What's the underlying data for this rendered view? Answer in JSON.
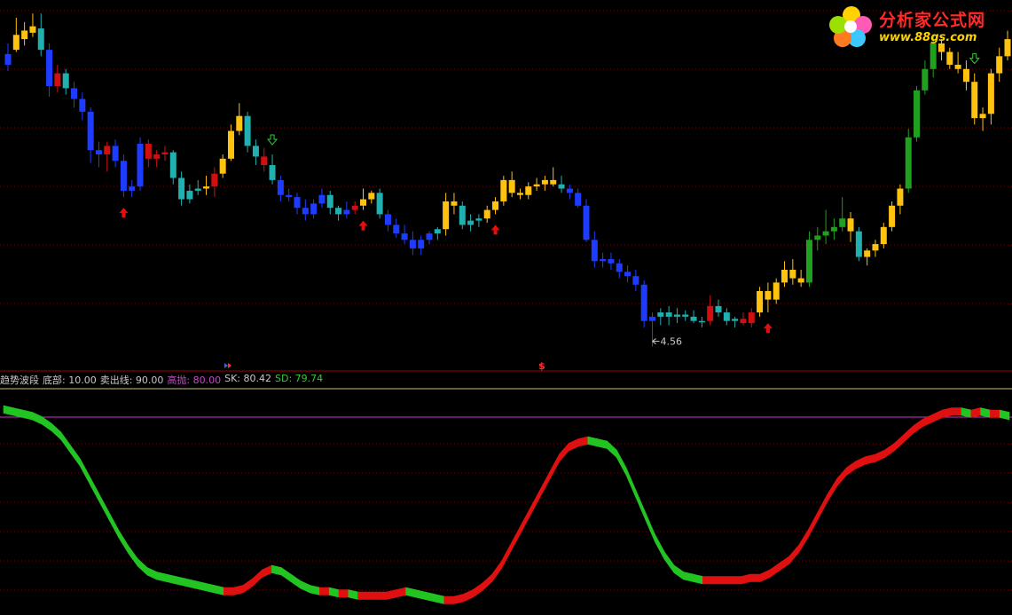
{
  "indicator": {
    "name": "趋势波段",
    "bottom_label": "底部: 10.00",
    "sell_label": "卖出线: 90.00",
    "high_label": "高抛: 80.00",
    "sk_label": "SK: 80.42",
    "sd_label": "SD: 79.74"
  },
  "price_annotation": "4.56",
  "signal_marker": "$",
  "logo": {
    "brand": "分析家公式网",
    "url": "www.88gs.com"
  },
  "colors": {
    "up_strong": "#ffc20e",
    "down_strong": "#1e3cff",
    "up_weak": "#d01010",
    "down_weak": "#20b0b0",
    "green": "#1fa01f",
    "grid": "#7a0000",
    "osc_green": "#22c422",
    "osc_red": "#e01010",
    "sell_line": "#cc33cc",
    "buy_arrow": "#e01010",
    "sell_arrow": "#33cc33"
  },
  "chart_data": [
    {
      "type": "candlestick",
      "low_annotation": 4.56,
      "ohlc": [
        [
          5.88,
          5.98,
          5.85,
          5.93,
          "b"
        ],
        [
          5.95,
          6.1,
          5.94,
          6.02,
          "y"
        ],
        [
          6.0,
          6.08,
          5.97,
          6.04,
          "y"
        ],
        [
          6.03,
          6.12,
          6.01,
          6.06,
          "y"
        ],
        [
          6.05,
          6.12,
          5.92,
          5.95,
          "c"
        ],
        [
          5.95,
          5.98,
          5.73,
          5.78,
          "b"
        ],
        [
          5.78,
          5.88,
          5.75,
          5.84,
          "r"
        ],
        [
          5.84,
          5.86,
          5.74,
          5.77,
          "c"
        ],
        [
          5.77,
          5.8,
          5.68,
          5.72,
          "b"
        ],
        [
          5.72,
          5.75,
          5.62,
          5.66,
          "b"
        ],
        [
          5.66,
          5.68,
          5.42,
          5.48,
          "b"
        ],
        [
          5.48,
          5.52,
          5.4,
          5.46,
          "b"
        ],
        [
          5.46,
          5.52,
          5.38,
          5.5,
          "r"
        ],
        [
          5.5,
          5.53,
          5.4,
          5.43,
          "b"
        ],
        [
          5.43,
          5.46,
          5.26,
          5.29,
          "b"
        ],
        [
          5.29,
          5.34,
          5.26,
          5.31,
          "b"
        ],
        [
          5.31,
          5.54,
          5.29,
          5.51,
          "b"
        ],
        [
          5.51,
          5.53,
          5.4,
          5.44,
          "r"
        ],
        [
          5.44,
          5.48,
          5.4,
          5.46,
          "r"
        ],
        [
          5.46,
          5.5,
          5.43,
          5.47,
          "r"
        ],
        [
          5.47,
          5.48,
          5.32,
          5.35,
          "c"
        ],
        [
          5.35,
          5.38,
          5.22,
          5.25,
          "c"
        ],
        [
          5.25,
          5.32,
          5.23,
          5.29,
          "c"
        ],
        [
          5.29,
          5.34,
          5.27,
          5.3,
          "c"
        ],
        [
          5.3,
          5.36,
          5.27,
          5.31,
          "y"
        ],
        [
          5.31,
          5.4,
          5.26,
          5.37,
          "r"
        ],
        [
          5.37,
          5.46,
          5.35,
          5.44,
          "y"
        ],
        [
          5.44,
          5.6,
          5.43,
          5.57,
          "y"
        ],
        [
          5.57,
          5.7,
          5.55,
          5.64,
          "y"
        ],
        [
          5.64,
          5.66,
          5.47,
          5.5,
          "c"
        ],
        [
          5.5,
          5.53,
          5.41,
          5.45,
          "c"
        ],
        [
          5.45,
          5.49,
          5.38,
          5.41,
          "r"
        ],
        [
          5.41,
          5.46,
          5.32,
          5.34,
          "c"
        ],
        [
          5.34,
          5.36,
          5.24,
          5.27,
          "b"
        ],
        [
          5.27,
          5.3,
          5.24,
          5.26,
          "b"
        ],
        [
          5.26,
          5.28,
          5.18,
          5.21,
          "b"
        ],
        [
          5.21,
          5.25,
          5.15,
          5.18,
          "b"
        ],
        [
          5.18,
          5.25,
          5.16,
          5.23,
          "b"
        ],
        [
          5.23,
          5.3,
          5.21,
          5.27,
          "b"
        ],
        [
          5.27,
          5.29,
          5.18,
          5.21,
          "c"
        ],
        [
          5.21,
          5.22,
          5.15,
          5.18,
          "c"
        ],
        [
          5.18,
          5.24,
          5.16,
          5.2,
          "b"
        ],
        [
          5.2,
          5.24,
          5.18,
          5.22,
          "r"
        ],
        [
          5.22,
          5.3,
          5.2,
          5.25,
          "y"
        ],
        [
          5.25,
          5.29,
          5.23,
          5.28,
          "y"
        ],
        [
          5.28,
          5.3,
          5.16,
          5.18,
          "c"
        ],
        [
          5.18,
          5.2,
          5.1,
          5.13,
          "b"
        ],
        [
          5.13,
          5.16,
          5.07,
          5.09,
          "b"
        ],
        [
          5.09,
          5.13,
          5.04,
          5.06,
          "b"
        ],
        [
          5.06,
          5.1,
          4.99,
          5.02,
          "b"
        ],
        [
          5.02,
          5.08,
          4.99,
          5.06,
          "b"
        ],
        [
          5.06,
          5.1,
          5.04,
          5.09,
          "b"
        ],
        [
          5.09,
          5.12,
          5.06,
          5.11,
          "c"
        ],
        [
          5.11,
          5.28,
          5.08,
          5.24,
          "y"
        ],
        [
          5.24,
          5.28,
          5.18,
          5.22,
          "y"
        ],
        [
          5.22,
          5.24,
          5.11,
          5.13,
          "c"
        ],
        [
          5.13,
          5.18,
          5.1,
          5.15,
          "c"
        ],
        [
          5.15,
          5.18,
          5.12,
          5.16,
          "c"
        ],
        [
          5.16,
          5.22,
          5.14,
          5.2,
          "y"
        ],
        [
          5.2,
          5.26,
          5.18,
          5.24,
          "y"
        ],
        [
          5.24,
          5.36,
          5.22,
          5.34,
          "y"
        ],
        [
          5.34,
          5.38,
          5.26,
          5.28,
          "y"
        ],
        [
          5.28,
          5.3,
          5.25,
          5.27,
          "y"
        ],
        [
          5.27,
          5.33,
          5.25,
          5.31,
          "y"
        ],
        [
          5.31,
          5.35,
          5.29,
          5.32,
          "y"
        ],
        [
          5.32,
          5.36,
          5.29,
          5.34,
          "y"
        ],
        [
          5.34,
          5.4,
          5.31,
          5.32,
          "y"
        ],
        [
          5.32,
          5.36,
          5.28,
          5.3,
          "c"
        ],
        [
          5.3,
          5.32,
          5.25,
          5.28,
          "b"
        ],
        [
          5.28,
          5.3,
          5.21,
          5.22,
          "b"
        ],
        [
          5.22,
          5.25,
          5.05,
          5.06,
          "b"
        ],
        [
          5.06,
          5.1,
          4.93,
          4.96,
          "b"
        ],
        [
          4.96,
          5.0,
          4.93,
          4.97,
          "b"
        ],
        [
          4.97,
          5.0,
          4.92,
          4.95,
          "b"
        ],
        [
          4.95,
          4.97,
          4.88,
          4.91,
          "b"
        ],
        [
          4.91,
          4.94,
          4.86,
          4.89,
          "b"
        ],
        [
          4.89,
          4.92,
          4.82,
          4.85,
          "b"
        ],
        [
          4.85,
          4.87,
          4.65,
          4.68,
          "b"
        ],
        [
          4.68,
          4.72,
          4.56,
          4.7,
          "b"
        ],
        [
          4.7,
          4.74,
          4.66,
          4.72,
          "c"
        ],
        [
          4.72,
          4.75,
          4.66,
          4.7,
          "c"
        ],
        [
          4.7,
          4.74,
          4.67,
          4.71,
          "c"
        ],
        [
          4.71,
          4.73,
          4.68,
          4.7,
          "c"
        ],
        [
          4.7,
          4.73,
          4.67,
          4.68,
          "c"
        ],
        [
          4.68,
          4.7,
          4.65,
          4.68,
          "c"
        ],
        [
          4.68,
          4.8,
          4.66,
          4.75,
          "r"
        ],
        [
          4.75,
          4.78,
          4.7,
          4.72,
          "c"
        ],
        [
          4.72,
          4.74,
          4.66,
          4.68,
          "c"
        ],
        [
          4.68,
          4.7,
          4.65,
          4.69,
          "c"
        ],
        [
          4.69,
          4.72,
          4.66,
          4.67,
          "r"
        ],
        [
          4.67,
          4.74,
          4.65,
          4.72,
          "r"
        ],
        [
          4.72,
          4.84,
          4.7,
          4.82,
          "y"
        ],
        [
          4.82,
          4.86,
          4.72,
          4.78,
          "y"
        ],
        [
          4.78,
          4.88,
          4.76,
          4.86,
          "y"
        ],
        [
          4.86,
          4.96,
          4.84,
          4.92,
          "y"
        ],
        [
          4.92,
          4.97,
          4.85,
          4.88,
          "y"
        ],
        [
          4.88,
          4.92,
          4.84,
          4.86,
          "y"
        ],
        [
          4.86,
          5.1,
          4.84,
          5.06,
          "g"
        ],
        [
          5.06,
          5.12,
          5.01,
          5.08,
          "g"
        ],
        [
          5.08,
          5.2,
          5.04,
          5.1,
          "g"
        ],
        [
          5.1,
          5.16,
          5.06,
          5.12,
          "g"
        ],
        [
          5.12,
          5.26,
          5.1,
          5.16,
          "g"
        ],
        [
          5.16,
          5.19,
          5.05,
          5.1,
          "y"
        ],
        [
          5.1,
          5.12,
          4.96,
          4.98,
          "c"
        ],
        [
          4.98,
          5.02,
          4.94,
          5.01,
          "y"
        ],
        [
          5.01,
          5.06,
          4.98,
          5.04,
          "y"
        ],
        [
          5.04,
          5.14,
          5.02,
          5.12,
          "y"
        ],
        [
          5.12,
          5.24,
          5.1,
          5.22,
          "y"
        ],
        [
          5.22,
          5.32,
          5.18,
          5.3,
          "y"
        ],
        [
          5.3,
          5.58,
          5.28,
          5.54,
          "g"
        ],
        [
          5.54,
          5.78,
          5.52,
          5.76,
          "g"
        ],
        [
          5.76,
          5.9,
          5.74,
          5.86,
          "g"
        ],
        [
          5.86,
          6.02,
          5.82,
          5.98,
          "g"
        ],
        [
          5.98,
          6.0,
          5.9,
          5.94,
          "y"
        ],
        [
          5.94,
          5.96,
          5.86,
          5.88,
          "y"
        ],
        [
          5.88,
          5.94,
          5.84,
          5.86,
          "y"
        ],
        [
          5.86,
          5.9,
          5.76,
          5.8,
          "y"
        ],
        [
          5.8,
          5.84,
          5.6,
          5.63,
          "y"
        ],
        [
          5.63,
          5.68,
          5.57,
          5.65,
          "y"
        ],
        [
          5.65,
          5.86,
          5.6,
          5.84,
          "y"
        ],
        [
          5.84,
          5.96,
          5.8,
          5.92,
          "y"
        ],
        [
          5.92,
          6.04,
          5.9,
          6.0,
          "y"
        ]
      ],
      "buy_arrows_at": [
        14,
        43,
        59,
        92
      ],
      "sell_arrows_at": [
        32,
        117
      ],
      "y_range": [
        4.5,
        6.15
      ]
    },
    {
      "type": "area",
      "name": "趋势波段",
      "series": [
        {
          "name": "SK",
          "values": [
            96,
            95,
            94,
            93,
            91,
            88,
            84,
            78,
            72,
            64,
            56,
            48,
            40,
            33,
            27,
            23,
            21,
            20,
            19,
            18,
            17,
            16,
            15,
            14,
            14,
            15,
            18,
            22,
            24,
            23,
            20,
            17,
            15,
            14,
            14,
            13,
            13,
            12,
            12,
            12,
            12,
            13,
            14,
            13,
            12,
            11,
            10,
            10,
            11,
            13,
            16,
            20,
            26,
            34,
            42,
            50,
            58,
            66,
            74,
            79,
            81,
            82,
            81,
            80,
            76,
            68,
            58,
            48,
            38,
            30,
            24,
            21,
            20,
            19,
            19,
            19,
            19,
            19,
            20,
            20,
            22,
            25,
            28,
            33,
            40,
            48,
            56,
            63,
            68,
            71,
            73,
            74,
            76,
            79,
            83,
            87,
            90,
            92,
            94,
            95,
            95,
            94,
            95,
            94,
            94,
            93
          ]
        },
        {
          "name": "SD",
          "values": [
            95,
            94,
            93,
            92,
            90,
            87,
            83,
            77,
            71,
            63,
            55,
            47,
            39,
            32,
            26,
            22,
            20,
            19,
            18,
            17,
            16,
            15,
            14,
            13,
            13,
            14,
            17,
            21,
            23,
            22,
            19,
            16,
            14,
            13,
            13,
            12,
            12,
            11,
            11,
            11,
            11,
            12,
            13,
            12,
            11,
            10,
            9,
            9,
            10,
            12,
            15,
            19,
            25,
            33,
            41,
            49,
            57,
            65,
            73,
            78,
            80,
            81,
            80,
            79,
            75,
            67,
            57,
            47,
            37,
            29,
            23,
            20,
            19,
            18,
            18,
            18,
            18,
            18,
            19,
            19,
            21,
            24,
            27,
            32,
            39,
            47,
            55,
            62,
            67,
            70,
            72,
            73,
            75,
            78,
            82,
            86,
            89,
            91,
            93,
            94,
            94,
            93,
            94,
            93,
            93,
            92
          ]
        }
      ],
      "reference_lines": {
        "bottom": 10.0,
        "sell": 90.0,
        "high": 80.0
      },
      "last_values": {
        "SK": 80.42,
        "SD": 79.74
      },
      "y_range": [
        0,
        100
      ]
    }
  ]
}
